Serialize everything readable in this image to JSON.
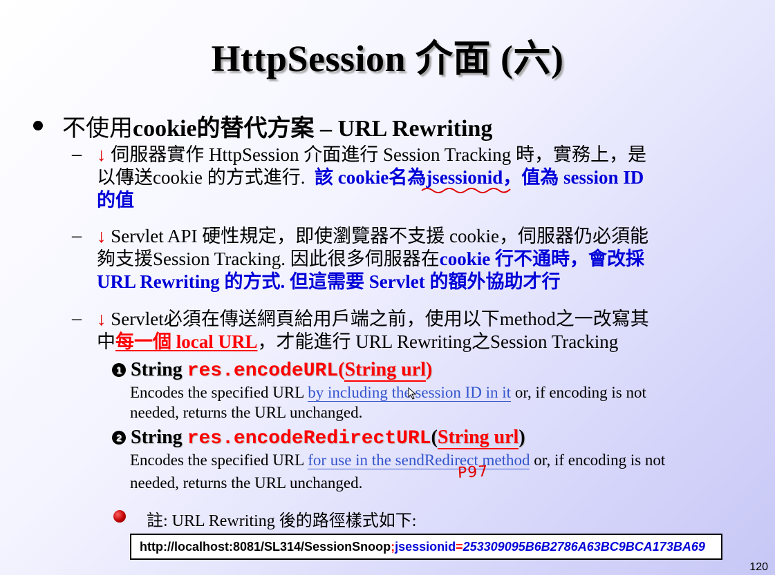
{
  "slide": {
    "title": "HttpSession 介面 (六)",
    "main_bullet": {
      "zh_prefix": "不使用",
      "bold_text": "cookie的替代方案 – URL Rewriting"
    },
    "dash": "–",
    "arrow": "↓",
    "items": [
      {
        "line1": "伺服器實作 HttpSession 介面進行 Session Tracking 時，實務上，是",
        "line2_plain": "以傳送cookie 的方式進行.",
        "line2_blue_a": "該 cookie名為",
        "line2_blue_b": "jsessionid",
        "line2_blue_c": "，值為 session ID",
        "line3_blue": "的值"
      },
      {
        "line1": "Servlet API 硬性規定，即使瀏覽器不支援 cookie，伺服器仍必須能",
        "line2_plain": "夠支援Session Tracking.  因此很多伺服器在",
        "line2_blue": "cookie 行不通時，會改採",
        "line3_blue": "URL Rewriting 的方式.  但這需要 Servlet 的額外協助才行"
      },
      {
        "line1": "Servlet必須在傳送網頁給用戶端之前，使用以下method之一改寫其",
        "line2_a": "中",
        "line2_red": "每一個 local URL",
        "line2_b": "，才能進行 URL Rewriting之Session Tracking"
      }
    ],
    "methods": [
      {
        "num": "1",
        "prefix": "String ",
        "name": "res.encodeURL",
        "open": "(",
        "param": "String url",
        "close": ")",
        "desc_a": "Encodes the specified URL ",
        "desc_link": "by including the session ID in it",
        "desc_b": " or,  if encoding is not",
        "desc_line2": "needed,  returns the URL unchanged."
      },
      {
        "num": "2",
        "prefix": "String ",
        "name": "res.encodeRedirectURL",
        "open": "(",
        "param": "String url",
        "close": ")",
        "desc_a": "Encodes the specified URL ",
        "desc_link": "for use in the sendRedirect method",
        "desc_b": " or,  if encoding is not",
        "desc_line2": "needed,  returns the URL unchanged."
      }
    ],
    "handwritten_note": "P97",
    "note": "註: URL Rewriting 後的路徑樣式如下:",
    "url_example": {
      "base": "http://localhost:8081/SL314/SessionSnoop",
      "separator": ";",
      "param_name": "jsessionid",
      "equals": "=",
      "session_id": "253309095B6B2786A63BC9BCA173BA69"
    },
    "page_number": "120",
    "colors": {
      "accent_red": "#ff0000",
      "accent_blue": "#0000d8",
      "link_blue": "#3355cc"
    }
  }
}
